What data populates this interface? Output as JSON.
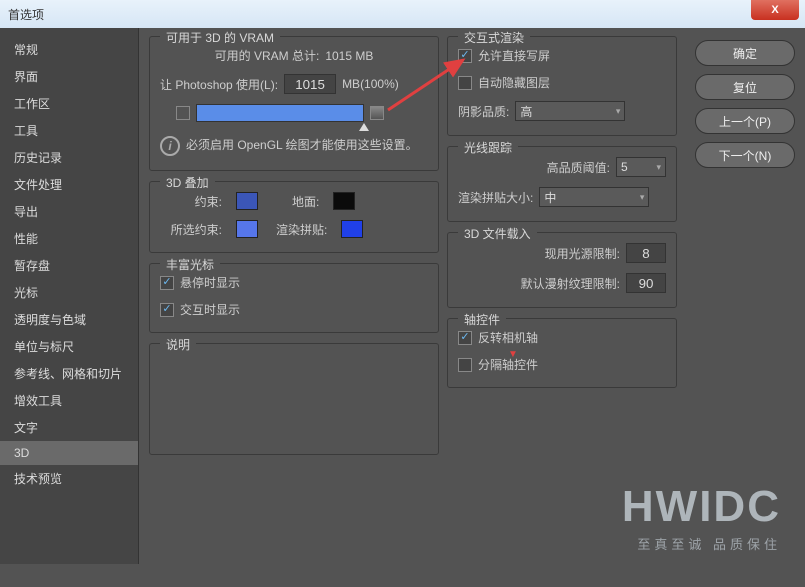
{
  "window": {
    "title": "首选项"
  },
  "sidebar": {
    "items": [
      {
        "label": "常规"
      },
      {
        "label": "界面"
      },
      {
        "label": "工作区"
      },
      {
        "label": "工具"
      },
      {
        "label": "历史记录"
      },
      {
        "label": "文件处理"
      },
      {
        "label": "导出"
      },
      {
        "label": "性能"
      },
      {
        "label": "暂存盘"
      },
      {
        "label": "光标"
      },
      {
        "label": "透明度与色域"
      },
      {
        "label": "单位与标尺"
      },
      {
        "label": "参考线、网格和切片"
      },
      {
        "label": "增效工具"
      },
      {
        "label": "文字"
      },
      {
        "label": "3D"
      },
      {
        "label": "技术预览"
      }
    ],
    "active_index": 15
  },
  "vram": {
    "section_title": "可用于 3D 的 VRAM",
    "total_label": "可用的 VRAM 总计:",
    "total_value": "1015 MB",
    "use_label": "让 Photoshop 使用(L):",
    "use_value": "1015",
    "use_unit": "MB(100%)",
    "warn_text": "必须启用 OpenGL 绘图才能使用这些设置。"
  },
  "overlay3d": {
    "section_title": "3D 叠加",
    "constraint_label": "约束:",
    "constraint_color": "#3b56b8",
    "ground_label": "地面:",
    "ground_color": "#0b0b0b",
    "selected_label": "所选约束:",
    "selected_color": "#5676ea",
    "tile_label": "渲染拼贴:",
    "tile_color": "#2040e8"
  },
  "cursor": {
    "section_title": "丰富光标",
    "hover_label": "悬停时显示",
    "hover_checked": true,
    "interact_label": "交互时显示",
    "interact_checked": true
  },
  "desc": {
    "section_title": "说明"
  },
  "render": {
    "section_title": "交互式渲染",
    "direct_label": "允许直接写屏",
    "direct_checked": true,
    "autohide_label": "自动隐藏图层",
    "autohide_checked": false,
    "shadow_label": "阴影品质:",
    "shadow_value": "高"
  },
  "raytrace": {
    "section_title": "光线跟踪",
    "thresh_label": "高品质阈值:",
    "thresh_value": "5",
    "tile_label": "渲染拼贴大小:",
    "tile_value": "中"
  },
  "fileload": {
    "section_title": "3D 文件载入",
    "light_label": "现用光源限制:",
    "light_value": "8",
    "texture_label": "默认漫射纹理限制:",
    "texture_value": "90"
  },
  "axis": {
    "section_title": "轴控件",
    "reverse_label": "反转相机轴",
    "reverse_checked": true,
    "separate_label": "分隔轴控件",
    "separate_checked": false
  },
  "buttons": {
    "ok": "确定",
    "reset": "复位",
    "prev": "上一个(P)",
    "next": "下一个(N)"
  },
  "watermark": {
    "big": "HWIDC",
    "small": "至真至诚 品质保住"
  }
}
